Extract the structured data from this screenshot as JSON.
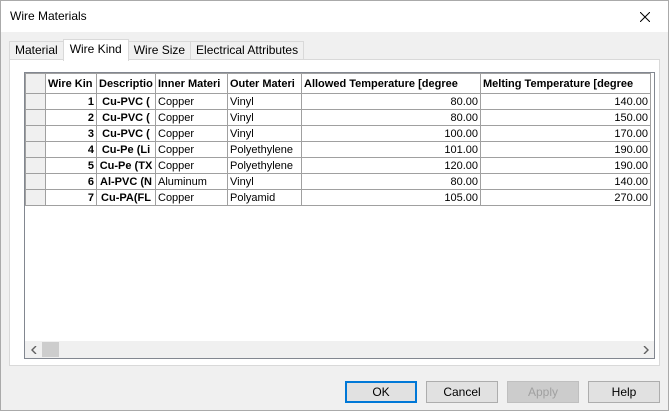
{
  "window": {
    "title": "Wire Materials"
  },
  "tabs": [
    {
      "label": "Material"
    },
    {
      "label": "Wire Kind"
    },
    {
      "label": "Wire Size"
    },
    {
      "label": "Electrical Attributes"
    }
  ],
  "grid": {
    "columns": [
      "Wire Kin",
      "Descriptio",
      "Inner Materi",
      "Outer Materi",
      "Allowed Temperature [degree",
      "Melting Temperature [degree"
    ],
    "rows": [
      [
        "1",
        "Cu-PVC (",
        "Copper",
        "Vinyl",
        "80.00",
        "140.00"
      ],
      [
        "2",
        "Cu-PVC (",
        "Copper",
        "Vinyl",
        "80.00",
        "150.00"
      ],
      [
        "3",
        "Cu-PVC (",
        "Copper",
        "Vinyl",
        "100.00",
        "170.00"
      ],
      [
        "4",
        "Cu-Pe (Li",
        "Copper",
        "Polyethylene",
        "101.00",
        "190.00"
      ],
      [
        "5",
        "Cu-Pe (TX",
        "Copper",
        "Polyethylene",
        "120.00",
        "190.00"
      ],
      [
        "6",
        "Al-PVC (N",
        "Aluminum",
        "Vinyl",
        "80.00",
        "140.00"
      ],
      [
        "7",
        "Cu-PA(FL",
        "Copper",
        "Polyamid",
        "105.00",
        "270.00"
      ]
    ]
  },
  "buttons": {
    "ok": "OK",
    "cancel": "Cancel",
    "apply": "Apply",
    "help": "Help"
  },
  "icons": {
    "close": "close-icon",
    "scroll_left": "chevron-left-icon",
    "scroll_right": "chevron-right-icon"
  }
}
